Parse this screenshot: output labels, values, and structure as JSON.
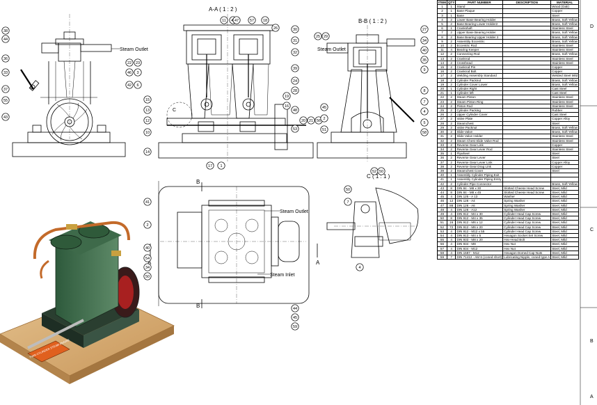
{
  "views": {
    "section_aa": "A-A ( 1 : 2 )",
    "section_bb": "B-B ( 1 : 2 )",
    "detail_c": "C ( 1 : 1 )",
    "detail_marker_c": "C",
    "steam_outlet": "Steam Outlet",
    "steam_inlet": "Steam Inlet",
    "cut_a": "A",
    "cut_b": "B"
  },
  "zones": {
    "right_1": "C",
    "right_2": "B",
    "right_3": "A",
    "right_top": "D"
  },
  "bom": {
    "headers": [
      "ITEM",
      "QTY",
      "PART NUMBER",
      "DESCRIPTION",
      "MATERIAL"
    ],
    "rows": [
      [
        "1",
        "1",
        "Stand",
        "",
        "Wood (Oak)"
      ],
      [
        "2",
        "1",
        "Base Plaque",
        "",
        "Copper"
      ],
      [
        "3",
        "1",
        "Base",
        "",
        "Steel"
      ],
      [
        "4",
        "2",
        "Lower Base Bearing Holder",
        "",
        "Brass, Soft Yellow"
      ],
      [
        "5",
        "2",
        "Base Bearing Lower Holder2",
        "",
        "Brass, Soft Yellow"
      ],
      [
        "6",
        "1",
        "Crankshaft",
        "",
        "Stainless Steel"
      ],
      [
        "7",
        "2",
        "Upper Base Bearing Holder",
        "",
        "Brass, Soft Yellow"
      ],
      [
        "8",
        "2",
        "Base Bearing Upper Holder 2",
        "",
        "Brass, Soft Yellow"
      ],
      [
        "9",
        "2",
        "Assembly Eccentric",
        "",
        "Brass, Soft Yellow"
      ],
      [
        "10",
        "2",
        "Eccentric Rod",
        "",
        "Stainless Steel"
      ],
      [
        "11",
        "4",
        "Bearing Keeper",
        "",
        "Stainless Steel"
      ],
      [
        "12",
        "2",
        "Connecting Rod",
        "",
        "Brass, Soft Yellow"
      ],
      [
        "13",
        "2",
        "Crankrod",
        "",
        "Stainless Steel"
      ],
      [
        "14",
        "2",
        "Crosshead",
        "",
        "Stainless Steel"
      ],
      [
        "15",
        "2",
        "Crankrod Pin",
        "",
        "Copper"
      ],
      [
        "16",
        "2",
        "Crankrod Bolt",
        "",
        "Copper"
      ],
      [
        "17",
        "2",
        "Welding Assembly Standard",
        "",
        "Welded Steel Mild"
      ],
      [
        "18",
        "2",
        "Cylinder Packnut",
        "",
        "Brass, Soft Yellow"
      ],
      [
        "19",
        "2",
        "Cylinder Cover Lower",
        "",
        "Brass, Soft Yellow"
      ],
      [
        "20",
        "1",
        "Cylinder Right",
        "",
        "Cast Steel"
      ],
      [
        "21",
        "1",
        "Cylinder left",
        "",
        "Cast Steel"
      ],
      [
        "22",
        "2",
        "Steam Piston",
        "",
        "Stainless Steel"
      ],
      [
        "23",
        "2",
        "Steam Piston Ring",
        "",
        "Stainless Steel"
      ],
      [
        "24",
        "2",
        "Piston Rod",
        "",
        "Stainless Steel"
      ],
      [
        "25",
        "2",
        "Cylinder Packing",
        "",
        "Rubber"
      ],
      [
        "26",
        "2",
        "Upper Cylinder Cover",
        "",
        "Cast Steel"
      ],
      [
        "27",
        "2",
        "Valve Plate",
        "",
        "Copper Alloy"
      ],
      [
        "28",
        "2",
        "Steamchest",
        "",
        "Steel"
      ],
      [
        "29",
        "2",
        "Valve Packnut",
        "",
        "Brass, Soft Yellow"
      ],
      [
        "30",
        "2",
        "Slide Valve",
        "",
        "Brass, Soft Yellow"
      ],
      [
        "31",
        "2",
        "Slide Valve Holder",
        "",
        "Stainless Steel"
      ],
      [
        "32",
        "2",
        "Steam Chest Slide Valve Rod",
        "",
        "Stainless Steel"
      ],
      [
        "33",
        "2",
        "Reverse Gear Link",
        "",
        "Copper"
      ],
      [
        "34",
        "2",
        "Reverse Gear Lever Rod",
        "",
        "Stainless Steel"
      ],
      [
        "35",
        "1",
        "Flywheel",
        "",
        "Steel"
      ],
      [
        "36",
        "2",
        "Reverse Gear Lever",
        "",
        "Steel"
      ],
      [
        "37",
        "2",
        "Reverse Gear Lever Link",
        "",
        "Copper Alloy"
      ],
      [
        "38",
        "2",
        "Reverse Gear Drag Link",
        "",
        "Copper"
      ],
      [
        "39",
        "2",
        "Steamchest Cover",
        "",
        "Steel"
      ],
      [
        "40",
        "1",
        "Assembly Cylinder Piping Exit",
        "",
        ""
      ],
      [
        "41",
        "1",
        "Assembly Cylinder Piping Entry",
        "",
        ""
      ],
      [
        "42",
        "2",
        "Cylinder Pipe Connector",
        "",
        "Brass, Soft Yellow"
      ],
      [
        "43",
        "8",
        "DIN 84 - M8 x 30",
        "Slotted Cheese Head Screw",
        "Steel, Mild"
      ],
      [
        "44",
        "8",
        "DIN 84 - M8 x 45",
        "Slotted Cheese Head Screw",
        "Steel, Mild"
      ],
      [
        "45",
        "4",
        "DIN 125 - A 13",
        "Washer",
        "Steel, Mild"
      ],
      [
        "46",
        "12",
        "DIN 128 - A4",
        "Spring Washer",
        "Steel, Mild"
      ],
      [
        "47",
        "88",
        "DIN 128 - A6",
        "Spring Washer",
        "Steel, Mild"
      ],
      [
        "48",
        "4",
        "DIN 128 - A12",
        "Spring Washer",
        "Steel, Mild"
      ],
      [
        "49",
        "4",
        "DIN 912 - M4 x 30",
        "Cylinder Head Cap Screw",
        "Steel, Mild"
      ],
      [
        "50",
        "8",
        "DIN 912 - M4 x 35",
        "Cylinder Head Cap Screw",
        "Steel, Mild"
      ],
      [
        "51",
        "16",
        "DIN 912 - M6 x 12",
        "Cylinder Head Cap Screw",
        "Steel, Mild"
      ],
      [
        "52",
        "72",
        "DIN 912 - M6 x 20",
        "Cylinder Head Cap Screw",
        "Steel, Mild"
      ],
      [
        "53",
        "4",
        "DIN 912 - M12 x 55",
        "Cylinder Head Cap Screw",
        "Steel, Mild"
      ],
      [
        "54",
        "4",
        "DIN 913 - M4 x 5",
        "Hexagon Socket Set Screw",
        "Steel, Mild"
      ],
      [
        "55",
        "4",
        "DIN 933 - M8 x 20",
        "Hex-Head Bolt",
        "Steel, Mild"
      ],
      [
        "56",
        "4",
        "DIN 934 - M8",
        "Hex Nut",
        "Steel, Mild"
      ],
      [
        "57",
        "4",
        "DIN 934 - M12",
        "Hex Nut",
        "Steel, Mild"
      ],
      [
        "58",
        "4",
        "DIN 1587 - M12",
        "Hexagon Domed Cap Nuts",
        "Steel, Mild"
      ],
      [
        "59",
        "7",
        "DIN 71412 - AM 6 (coned short)",
        "Lubricating Nipple, coned type A",
        "Steel, Mild"
      ]
    ]
  },
  "balloons": {
    "front": [
      "38",
      "44",
      "36",
      "33",
      "37",
      "55",
      "43"
    ],
    "aa": [
      "11",
      "49",
      "57",
      "18",
      "26",
      "30",
      "31",
      "32",
      "39",
      "24",
      "28",
      "19",
      "16",
      "15",
      "13",
      "12",
      "10",
      "14",
      "17",
      "1",
      "3",
      "6",
      "46",
      "42",
      "23",
      "22",
      "20",
      "21",
      "56",
      "48",
      "53",
      "47"
    ],
    "bb": [
      "25",
      "29",
      "27",
      "34",
      "40",
      "35",
      "9",
      "8",
      "7",
      "4",
      "5",
      "58",
      "45",
      "2",
      "51",
      "52",
      "50"
    ],
    "plan": [
      "41",
      "2",
      "40",
      "54",
      "34",
      "50",
      "44",
      "45",
      "59"
    ],
    "detail": [
      "50",
      "7",
      "4"
    ]
  },
  "iso": {
    "plaque_text": "TWIN CYLINDER STEAM ENGINE"
  }
}
